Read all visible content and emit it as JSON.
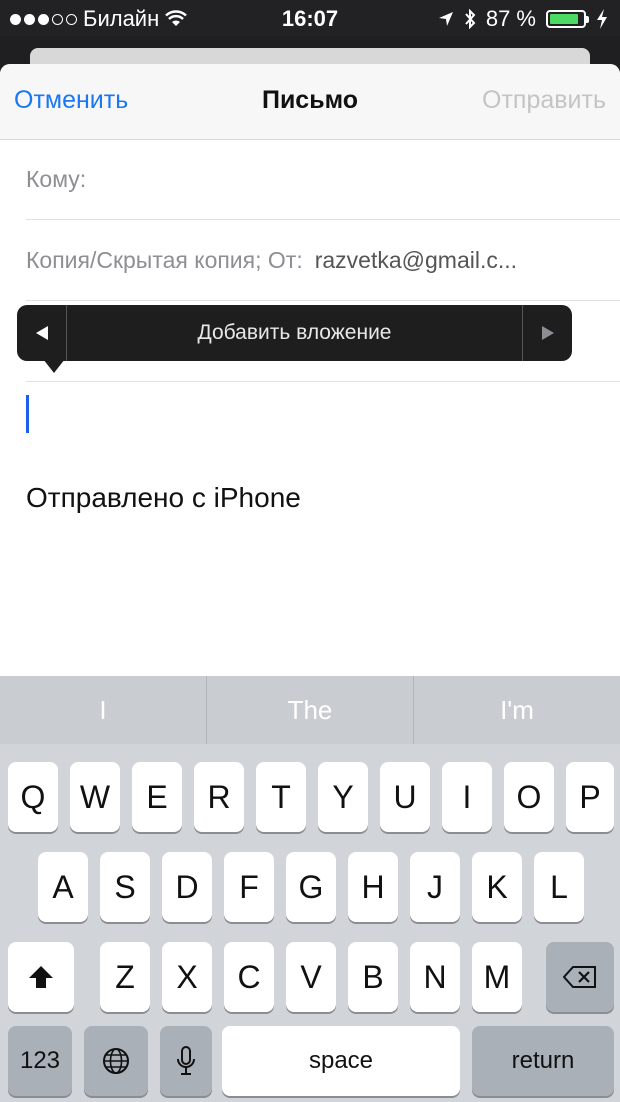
{
  "status": {
    "carrier": "Билайн",
    "time": "16:07",
    "battery": "87 %",
    "battery_level": 0.87
  },
  "nav": {
    "cancel": "Отменить",
    "title": "Письмо",
    "send": "Отправить"
  },
  "fields": {
    "to_label": "Кому:",
    "cc_label": "Копия/Скрытая копия; От:",
    "from_value": "razvetka@gmail.c..."
  },
  "popover": {
    "label": "Добавить вложение"
  },
  "body": {
    "signature": "Отправлено с iPhone"
  },
  "keyboard": {
    "suggestions": [
      "I",
      "The",
      "I'm"
    ],
    "row1": [
      "Q",
      "W",
      "E",
      "R",
      "T",
      "Y",
      "U",
      "I",
      "O",
      "P"
    ],
    "row2": [
      "A",
      "S",
      "D",
      "F",
      "G",
      "H",
      "J",
      "K",
      "L"
    ],
    "row3": [
      "Z",
      "X",
      "C",
      "V",
      "B",
      "N",
      "M"
    ],
    "numbers": "123",
    "space": "space",
    "return": "return"
  }
}
